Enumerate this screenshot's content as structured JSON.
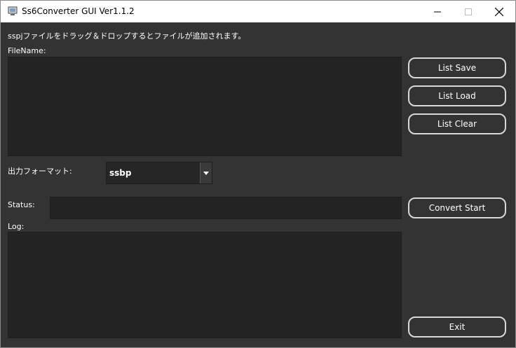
{
  "window": {
    "title": "Ss6Converter GUI Ver1.1.2",
    "icon": "app-icon",
    "controls": [
      "minimize-icon",
      "maximize-icon",
      "close-icon"
    ]
  },
  "main": {
    "hint": "sspjファイルをドラッグ＆ドロップするとファイルが追加されます。",
    "filename_label": "FileName:",
    "format_label": "出力フォーマット:",
    "format_value": "ssbp",
    "status_label": "Status:",
    "status_value": "",
    "log_label": "Log:",
    "log_value": ""
  },
  "buttons": {
    "list_save": "List Save",
    "list_load": "List Load",
    "list_clear": "List Clear",
    "convert_start": "Convert Start",
    "exit": "Exit"
  },
  "colors": {
    "background": "#333333",
    "panel": "#232323",
    "button_border": "#d8d8d8",
    "text": "#ffffff"
  }
}
